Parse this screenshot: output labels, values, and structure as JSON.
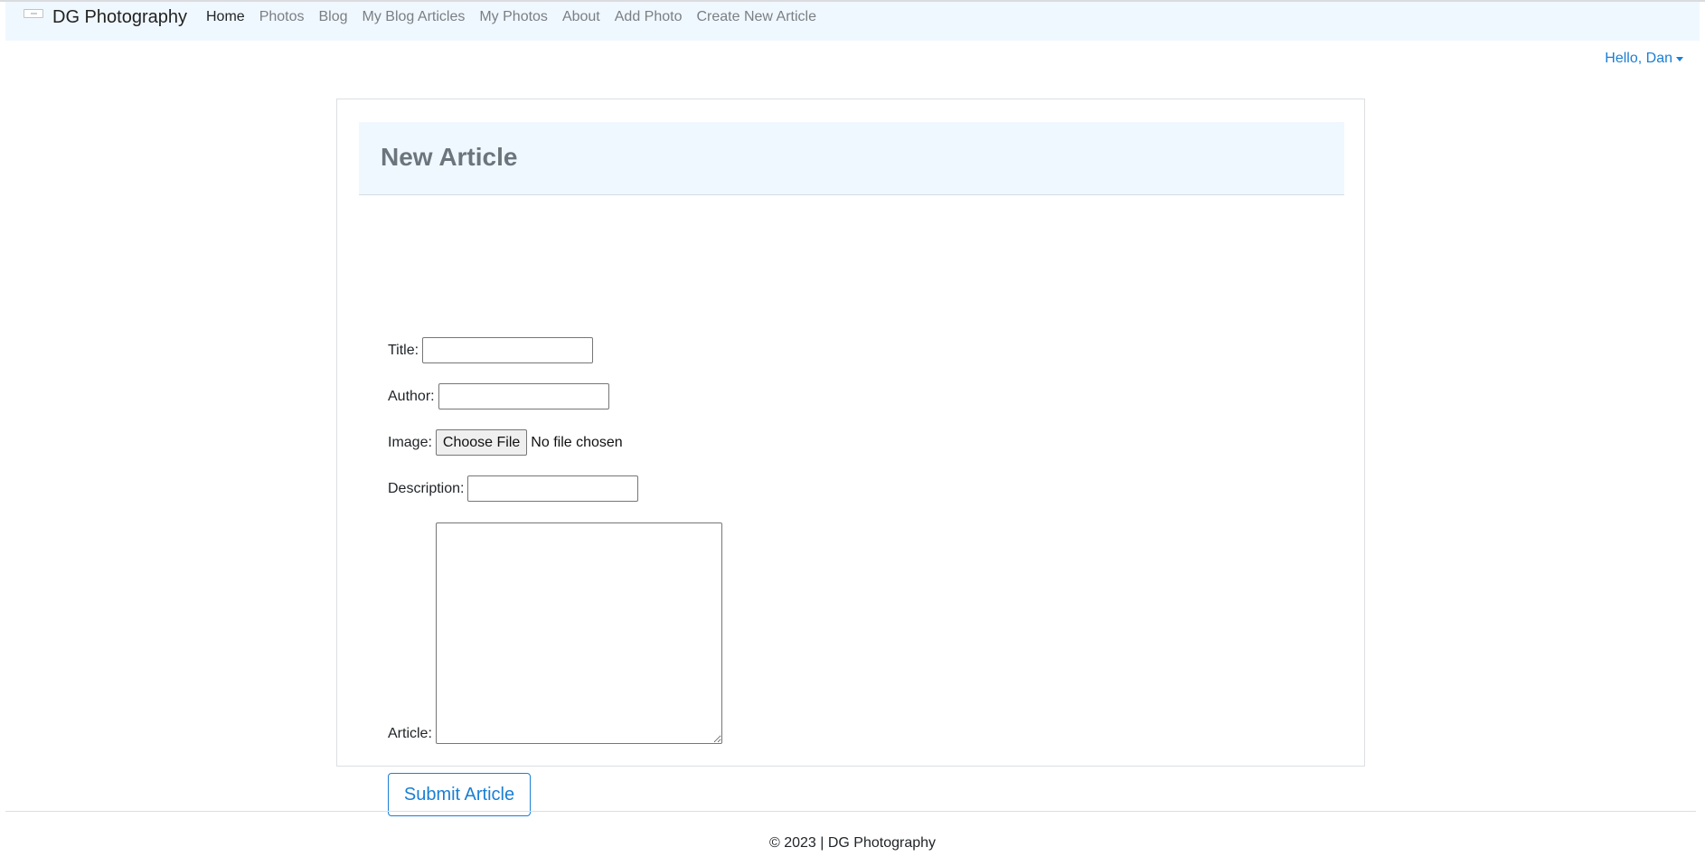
{
  "navbar": {
    "brand_logo": "DG",
    "brand": "DG Photography",
    "links": [
      {
        "label": "Home",
        "active": true
      },
      {
        "label": "Photos",
        "active": false
      },
      {
        "label": "Blog",
        "active": false
      },
      {
        "label": "My Blog Articles",
        "active": false
      },
      {
        "label": "My Photos",
        "active": false
      },
      {
        "label": "About",
        "active": false
      },
      {
        "label": "Add Photo",
        "active": false
      },
      {
        "label": "Create New Article",
        "active": false
      }
    ],
    "user_greeting": "Hello, Dan"
  },
  "card": {
    "title": "New Article"
  },
  "form": {
    "title_label": "Title:",
    "title_value": "",
    "author_label": "Author:",
    "author_value": "",
    "image_label": "Image:",
    "image_button": "Choose File",
    "image_status": "No file chosen",
    "description_label": "Description:",
    "description_value": "",
    "article_label": "Article:",
    "article_value": "",
    "submit_label": "Submit Article"
  },
  "footer": {
    "text": "© 2023 | DG Photography"
  },
  "colors": {
    "navbar_bg": "#f0f8ff",
    "link_active": "#212529",
    "link_muted": "#7a7f84",
    "accent": "#1a7fd4"
  }
}
